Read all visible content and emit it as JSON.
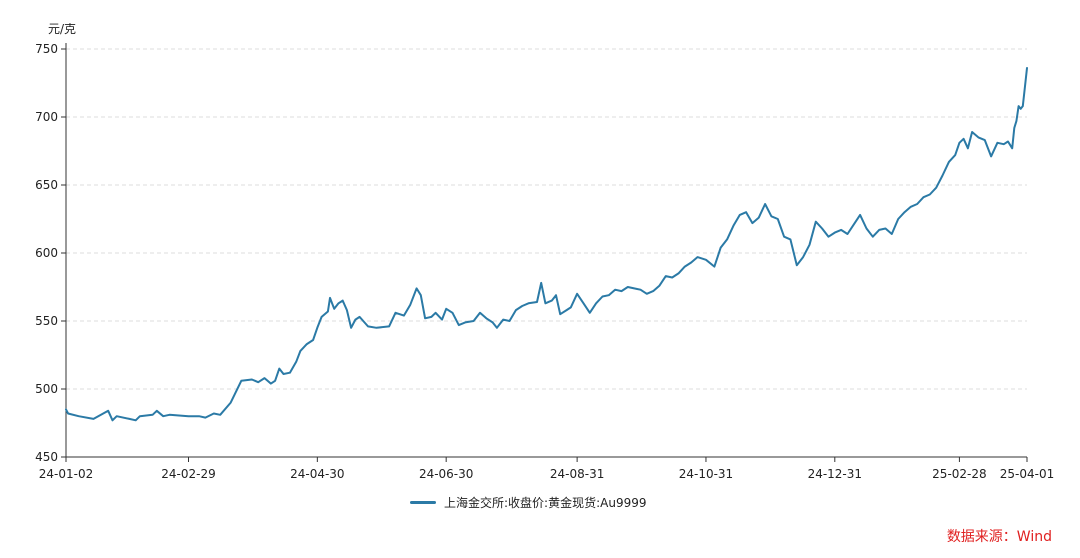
{
  "chart_data": {
    "type": "line",
    "ylabel": "元/克",
    "ylim": [
      450,
      750
    ],
    "y_ticks": [
      "750",
      "700",
      "650",
      "600",
      "550",
      "500",
      "450"
    ],
    "x_ticks": [
      "24-01-02",
      "24-02-29",
      "24-04-30",
      "24-06-30",
      "24-08-31",
      "24-10-31",
      "24-12-31",
      "25-02-28",
      "25-04-01"
    ],
    "grid": true,
    "legend_position": "bottom",
    "series": [
      {
        "name": "上海金交所:收盘价:黄金现货:Au9999",
        "color": "#2b7aa6",
        "points": [
          [
            "24-01-02",
            485
          ],
          [
            "24-01-03",
            482
          ],
          [
            "24-01-08",
            480
          ],
          [
            "24-01-15",
            478
          ],
          [
            "24-01-22",
            484
          ],
          [
            "24-01-24",
            477
          ],
          [
            "24-01-26",
            480
          ],
          [
            "24-02-01",
            478
          ],
          [
            "24-02-04",
            477
          ],
          [
            "24-02-06",
            480
          ],
          [
            "24-02-12",
            481
          ],
          [
            "24-02-14",
            484
          ],
          [
            "24-02-17",
            480
          ],
          [
            "24-02-20",
            481
          ],
          [
            "24-02-29",
            480
          ],
          [
            "24-03-05",
            480
          ],
          [
            "24-03-08",
            479
          ],
          [
            "24-03-12",
            482
          ],
          [
            "24-03-15",
            481
          ],
          [
            "24-03-20",
            490
          ],
          [
            "24-03-25",
            506
          ],
          [
            "24-03-30",
            507
          ],
          [
            "24-04-02",
            505
          ],
          [
            "24-04-05",
            508
          ],
          [
            "24-04-08",
            504
          ],
          [
            "24-04-10",
            506
          ],
          [
            "24-04-12",
            515
          ],
          [
            "24-04-14",
            511
          ],
          [
            "24-04-17",
            512
          ],
          [
            "24-04-20",
            520
          ],
          [
            "24-04-22",
            528
          ],
          [
            "24-04-25",
            533
          ],
          [
            "24-04-28",
            536
          ],
          [
            "24-04-30",
            545
          ],
          [
            "24-05-02",
            553
          ],
          [
            "24-05-05",
            557
          ],
          [
            "24-05-06",
            567
          ],
          [
            "24-05-08",
            559
          ],
          [
            "24-05-10",
            563
          ],
          [
            "24-05-12",
            565
          ],
          [
            "24-05-14",
            558
          ],
          [
            "24-05-16",
            545
          ],
          [
            "24-05-18",
            551
          ],
          [
            "24-05-20",
            553
          ],
          [
            "24-05-24",
            546
          ],
          [
            "24-05-28",
            545
          ],
          [
            "24-06-03",
            546
          ],
          [
            "24-06-06",
            556
          ],
          [
            "24-06-10",
            554
          ],
          [
            "24-06-13",
            562
          ],
          [
            "24-06-16",
            574
          ],
          [
            "24-06-18",
            569
          ],
          [
            "24-06-20",
            552
          ],
          [
            "24-06-23",
            553
          ],
          [
            "24-06-25",
            556
          ],
          [
            "24-06-28",
            551
          ],
          [
            "24-06-30",
            559
          ],
          [
            "24-07-03",
            556
          ],
          [
            "24-07-06",
            547
          ],
          [
            "24-07-09",
            549
          ],
          [
            "24-07-13",
            550
          ],
          [
            "24-07-16",
            556
          ],
          [
            "24-07-19",
            552
          ],
          [
            "24-07-22",
            549
          ],
          [
            "24-07-24",
            545
          ],
          [
            "24-07-27",
            551
          ],
          [
            "24-07-30",
            550
          ],
          [
            "24-08-02",
            558
          ],
          [
            "24-08-05",
            561
          ],
          [
            "24-08-08",
            563
          ],
          [
            "24-08-12",
            564
          ],
          [
            "24-08-14",
            578
          ],
          [
            "24-08-16",
            563
          ],
          [
            "24-08-19",
            565
          ],
          [
            "24-08-21",
            569
          ],
          [
            "24-08-23",
            555
          ],
          [
            "24-08-26",
            558
          ],
          [
            "24-08-28",
            560
          ],
          [
            "24-08-31",
            570
          ],
          [
            "24-09-03",
            563
          ],
          [
            "24-09-06",
            556
          ],
          [
            "24-09-09",
            563
          ],
          [
            "24-09-12",
            568
          ],
          [
            "24-09-15",
            569
          ],
          [
            "24-09-18",
            573
          ],
          [
            "24-09-21",
            572
          ],
          [
            "24-09-24",
            575
          ],
          [
            "24-09-27",
            574
          ],
          [
            "24-09-30",
            573
          ],
          [
            "24-10-03",
            570
          ],
          [
            "24-10-06",
            572
          ],
          [
            "24-10-09",
            576
          ],
          [
            "24-10-12",
            583
          ],
          [
            "24-10-15",
            582
          ],
          [
            "24-10-18",
            585
          ],
          [
            "24-10-21",
            590
          ],
          [
            "24-10-24",
            593
          ],
          [
            "24-10-27",
            597
          ],
          [
            "24-10-31",
            595
          ],
          [
            "24-11-04",
            590
          ],
          [
            "24-11-07",
            604
          ],
          [
            "24-11-10",
            610
          ],
          [
            "24-11-13",
            620
          ],
          [
            "24-11-16",
            628
          ],
          [
            "24-11-19",
            630
          ],
          [
            "24-11-22",
            622
          ],
          [
            "24-11-25",
            626
          ],
          [
            "24-11-28",
            636
          ],
          [
            "24-12-01",
            627
          ],
          [
            "24-12-04",
            625
          ],
          [
            "24-12-07",
            612
          ],
          [
            "24-12-10",
            610
          ],
          [
            "24-12-13",
            591
          ],
          [
            "24-12-16",
            597
          ],
          [
            "24-12-19",
            606
          ],
          [
            "24-12-22",
            623
          ],
          [
            "24-12-25",
            618
          ],
          [
            "24-12-28",
            612
          ],
          [
            "24-12-31",
            615
          ],
          [
            "25-01-03",
            617
          ],
          [
            "25-01-06",
            614
          ],
          [
            "25-01-09",
            621
          ],
          [
            "25-01-12",
            628
          ],
          [
            "25-01-15",
            618
          ],
          [
            "25-01-18",
            612
          ],
          [
            "25-01-21",
            617
          ],
          [
            "25-01-24",
            618
          ],
          [
            "25-01-27",
            614
          ],
          [
            "25-01-30",
            625
          ],
          [
            "25-02-02",
            630
          ],
          [
            "25-02-05",
            634
          ],
          [
            "25-02-08",
            636
          ],
          [
            "25-02-11",
            641
          ],
          [
            "25-02-14",
            643
          ],
          [
            "25-02-17",
            648
          ],
          [
            "25-02-20",
            657
          ],
          [
            "25-02-23",
            667
          ],
          [
            "25-02-26",
            672
          ],
          [
            "25-02-28",
            681
          ],
          [
            "25-03-02",
            684
          ],
          [
            "25-03-04",
            677
          ],
          [
            "25-03-06",
            689
          ],
          [
            "25-03-09",
            685
          ],
          [
            "25-03-12",
            683
          ],
          [
            "25-03-15",
            671
          ],
          [
            "25-03-18",
            681
          ],
          [
            "25-03-21",
            680
          ],
          [
            "25-03-23",
            682
          ],
          [
            "25-03-25",
            677
          ],
          [
            "25-03-26",
            692
          ],
          [
            "25-03-27",
            697
          ],
          [
            "25-03-28",
            708
          ],
          [
            "25-03-29",
            706
          ],
          [
            "25-03-30",
            708
          ],
          [
            "25-03-31",
            722
          ],
          [
            "25-04-01",
            736
          ]
        ]
      }
    ]
  },
  "source_note": "数据来源：Wind"
}
